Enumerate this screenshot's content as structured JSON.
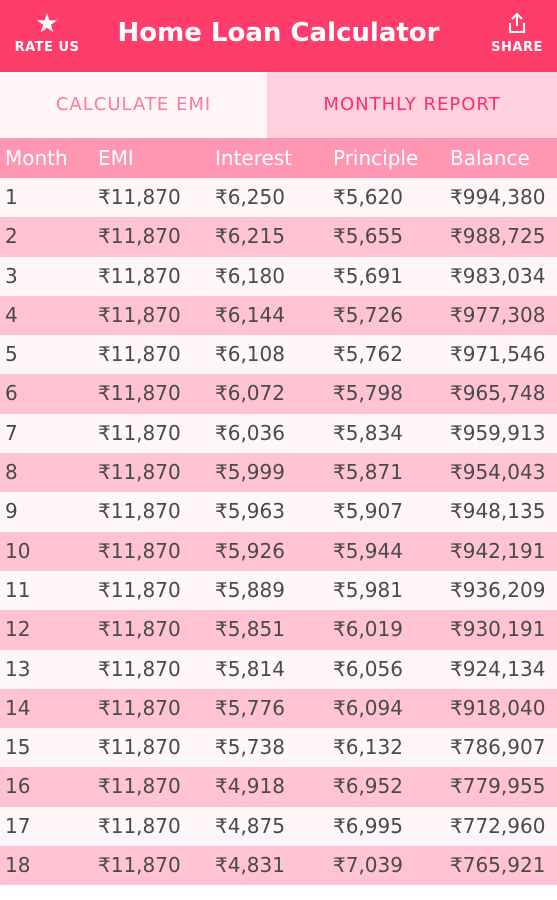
{
  "appbar": {
    "title": "Home Loan Calculator",
    "rate_label": "RATE US",
    "share_label": "SHARE",
    "color": "#ff3d6b"
  },
  "tabs": [
    {
      "label": "CALCULATE EMI"
    },
    {
      "label": "MONTHLY REPORT"
    }
  ],
  "table": {
    "headers": [
      "Month",
      "EMI",
      "Interest",
      "Principle",
      "Balance"
    ],
    "rows": [
      [
        "1",
        "₹11,870",
        "₹6,250",
        "₹5,620",
        "₹994,380"
      ],
      [
        "2",
        "₹11,870",
        "₹6,215",
        "₹5,655",
        "₹988,725"
      ],
      [
        "3",
        "₹11,870",
        "₹6,180",
        "₹5,691",
        "₹983,034"
      ],
      [
        "4",
        "₹11,870",
        "₹6,144",
        "₹5,726",
        "₹977,308"
      ],
      [
        "5",
        "₹11,870",
        "₹6,108",
        "₹5,762",
        "₹971,546"
      ],
      [
        "6",
        "₹11,870",
        "₹6,072",
        "₹5,798",
        "₹965,748"
      ],
      [
        "7",
        "₹11,870",
        "₹6,036",
        "₹5,834",
        "₹959,913"
      ],
      [
        "8",
        "₹11,870",
        "₹5,999",
        "₹5,871",
        "₹954,043"
      ],
      [
        "9",
        "₹11,870",
        "₹5,963",
        "₹5,907",
        "₹948,135"
      ],
      [
        "10",
        "₹11,870",
        "₹5,926",
        "₹5,944",
        "₹942,191"
      ],
      [
        "11",
        "₹11,870",
        "₹5,889",
        "₹5,981",
        "₹936,209"
      ],
      [
        "12",
        "₹11,870",
        "₹5,851",
        "₹6,019",
        "₹930,191"
      ],
      [
        "13",
        "₹11,870",
        "₹5,814",
        "₹6,056",
        "₹924,134"
      ],
      [
        "14",
        "₹11,870",
        "₹5,776",
        "₹6,094",
        "₹918,040"
      ],
      [
        "15",
        "₹11,870",
        "₹5,738",
        "₹6,132",
        "₹786,907"
      ],
      [
        "16",
        "₹11,870",
        "₹4,918",
        "₹6,952",
        "₹779,955"
      ],
      [
        "17",
        "₹11,870",
        "₹4,875",
        "₹6,995",
        "₹772,960"
      ],
      [
        "18",
        "₹11,870",
        "₹4,831",
        "₹7,039",
        "₹765,921"
      ]
    ]
  }
}
